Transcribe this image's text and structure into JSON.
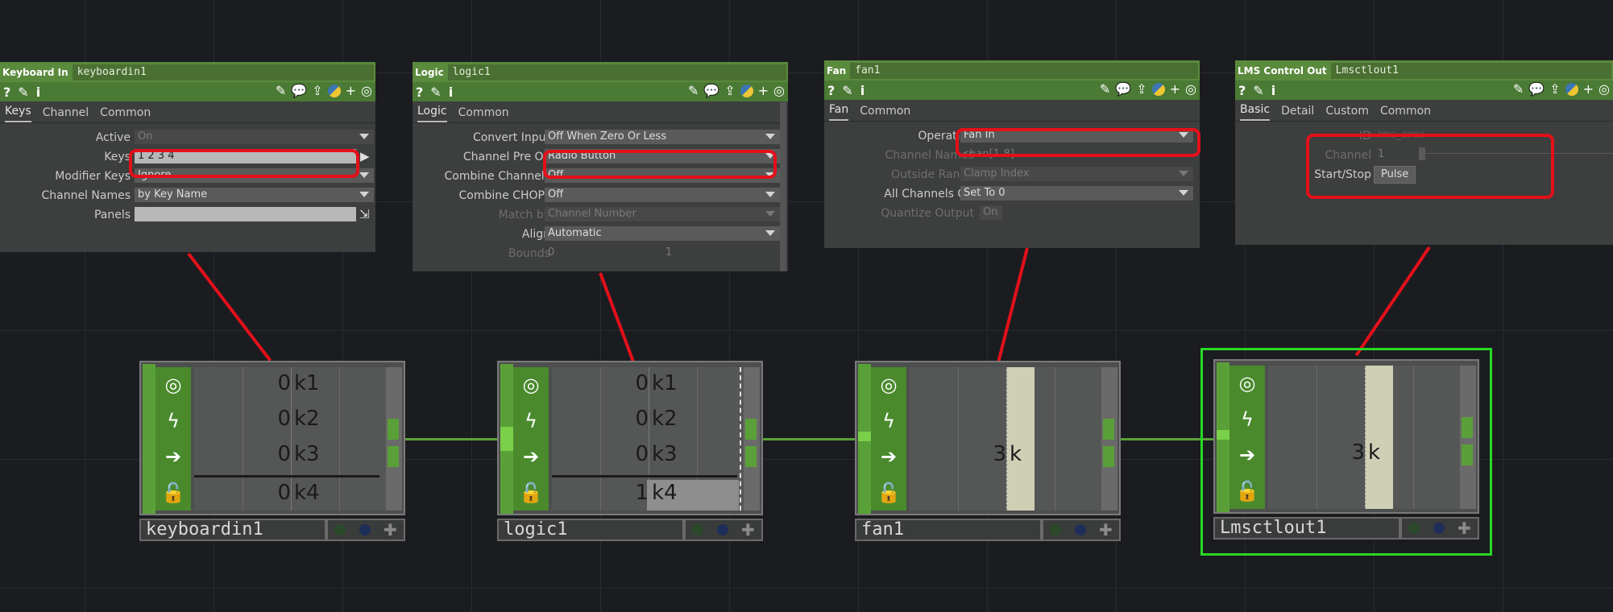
{
  "panels": [
    {
      "op_type": "Keyboard In",
      "op_name": "keyboardin1",
      "tabs": [
        "Keys",
        "Channel",
        "Common"
      ],
      "rows": [
        {
          "label": "Active",
          "value": "On"
        },
        {
          "label": "Keys",
          "value": "1 2 3 4"
        },
        {
          "label": "Modifier Keys",
          "value": "Ignore"
        },
        {
          "label": "Channel Names",
          "value": "by Key Name"
        },
        {
          "label": "Panels",
          "value": ""
        }
      ]
    },
    {
      "op_type": "Logic",
      "op_name": "logic1",
      "tabs": [
        "Logic",
        "Common"
      ],
      "rows": [
        {
          "label": "Convert Input",
          "value": "Off When Zero Or Less"
        },
        {
          "label": "Channel Pre OP",
          "value": "Radio Button"
        },
        {
          "label": "Combine Channels",
          "value": "Off"
        },
        {
          "label": "Combine CHOPs",
          "value": "Off"
        },
        {
          "label": "Match by",
          "value": "Channel Number"
        },
        {
          "label": "Align",
          "value": "Automatic"
        },
        {
          "label": "Bounds",
          "value": "0",
          "value2": "1"
        }
      ]
    },
    {
      "op_type": "Fan",
      "op_name": "fan1",
      "tabs": [
        "Fan",
        "Common"
      ],
      "rows": [
        {
          "label": "Operation",
          "value": "Fan In"
        },
        {
          "label": "Channel Names",
          "value": "chan[1-8]"
        },
        {
          "label": "Outside Range",
          "value": "Clamp Index"
        },
        {
          "label": "All Channels Off",
          "value": "Set To 0"
        },
        {
          "label": "Quantize Output",
          "value": "On"
        }
      ]
    },
    {
      "op_type": "LMS Control Out",
      "op_name": "Lmsctlout1",
      "tabs": [
        "Basic",
        "Detail",
        "Custom",
        "Common"
      ],
      "rows": [
        {
          "label": "ID",
          "value": "lms_area"
        },
        {
          "label": "Channel",
          "value": "1"
        },
        {
          "label": "Start/Stop",
          "value": "Pulse"
        }
      ]
    }
  ],
  "nodes": [
    {
      "name": "keyboardin1",
      "channels": [
        {
          "v": "0",
          "n": "k1"
        },
        {
          "v": "0",
          "n": "k2"
        },
        {
          "v": "0",
          "n": "k3"
        },
        {
          "v": "0",
          "n": "k4"
        }
      ]
    },
    {
      "name": "logic1",
      "channels": [
        {
          "v": "0",
          "n": "k1"
        },
        {
          "v": "0",
          "n": "k2"
        },
        {
          "v": "0",
          "n": "k3"
        },
        {
          "v": "1",
          "n": "k4"
        }
      ]
    },
    {
      "name": "fan1",
      "channels": [
        {
          "v": "3",
          "n": "k"
        }
      ]
    },
    {
      "name": "Lmsctlout1",
      "channels": [
        {
          "v": "3",
          "n": "k"
        }
      ]
    }
  ],
  "colors": {
    "accent": "#5aa038",
    "highlight": "#e3101a",
    "selected": "#26d926",
    "background": "#1b1c20"
  },
  "icons": [
    "help-icon",
    "python-edit-icon",
    "info-icon",
    "pencil-icon",
    "comment-icon",
    "clone-icon",
    "python-icon",
    "add-icon",
    "target-icon",
    "viewer-icon",
    "bypass-icon",
    "cook-arrow-icon",
    "lock-icon"
  ]
}
